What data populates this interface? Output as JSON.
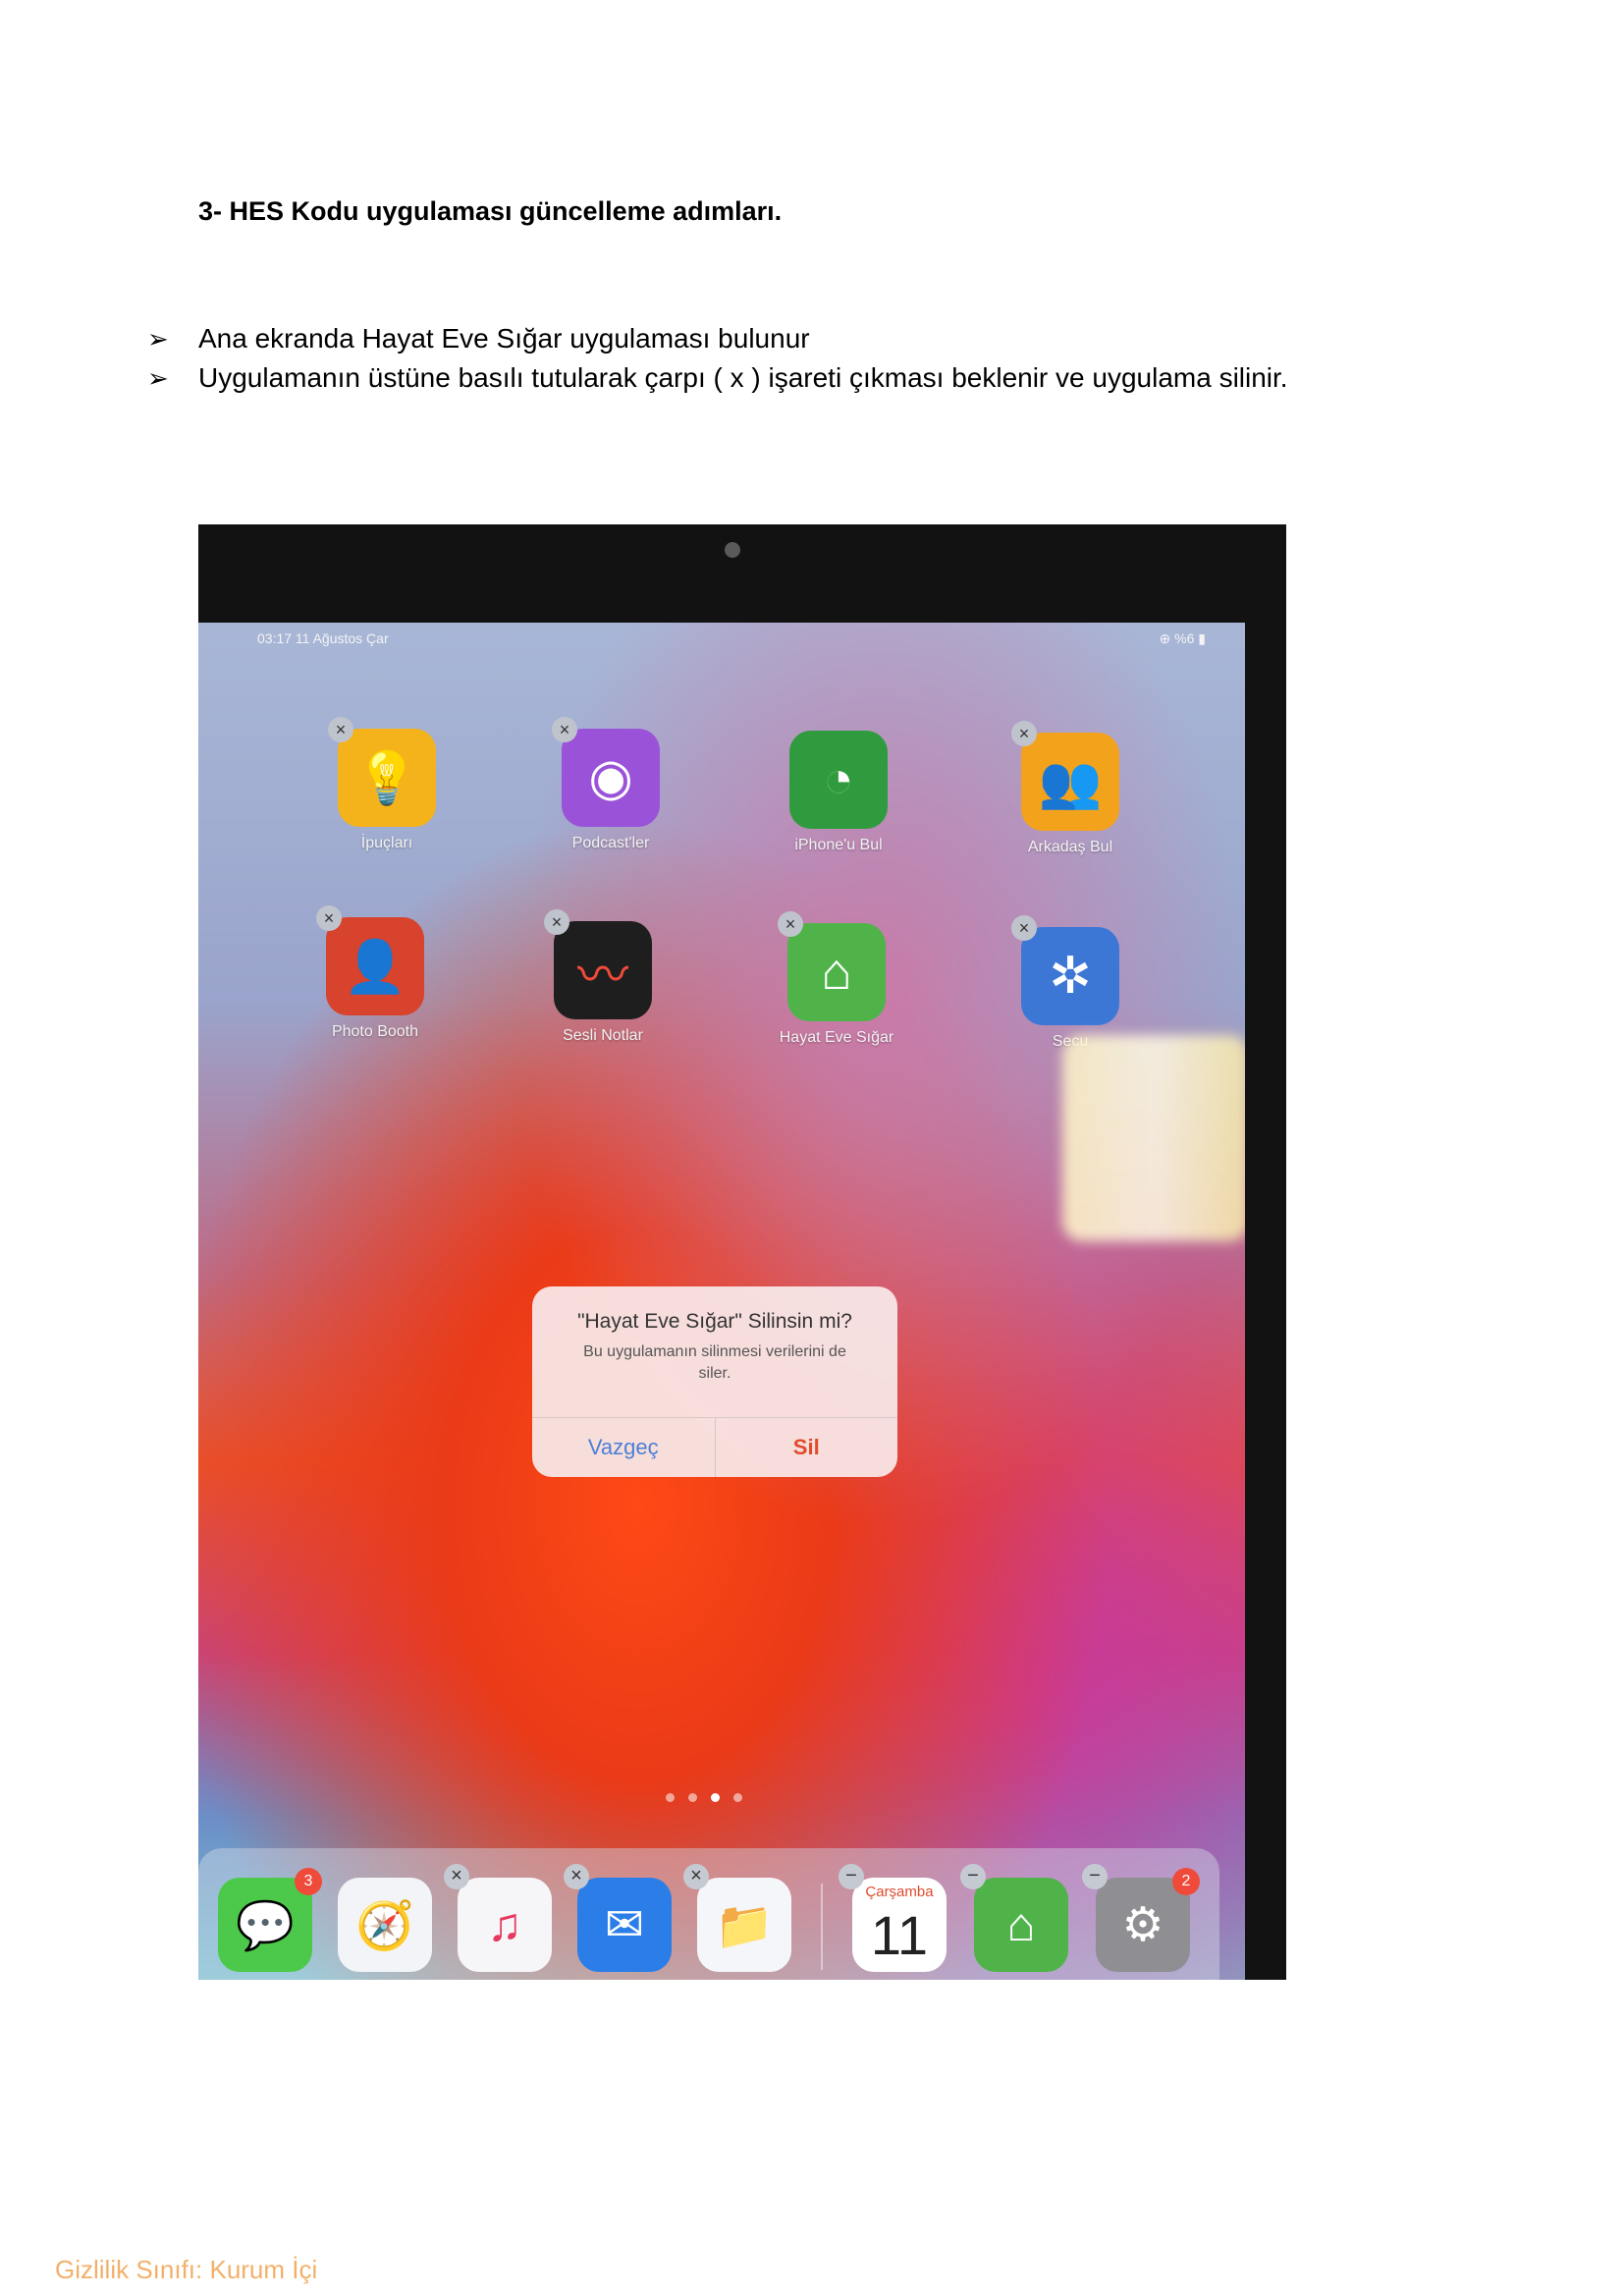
{
  "document": {
    "heading": "3- HES Kodu uygulaması güncelleme adımları.",
    "bullets": [
      "Ana ekranda Hayat Eve Sığar uygulaması bulunur",
      "Uygulamanın üstüne basılı tutularak çarpı ( x ) işareti çıkması beklenir ve uygulama silinir."
    ],
    "footer": "Gizlilik Sınıfı: Kurum İçi"
  },
  "screenshot": {
    "status": {
      "time_date": "03:17   11 Ağustos Çar",
      "battery": "%6"
    },
    "apps": [
      {
        "label": "İpuçları",
        "icon": "lightbulb-icon",
        "color": "#f4b31a",
        "delete_badge": true
      },
      {
        "label": "Podcast'ler",
        "icon": "podcast-icon",
        "color": "#9a52d9",
        "delete_badge": true
      },
      {
        "label": "iPhone'u Bul",
        "icon": "radar-icon",
        "color": "#2f9b3e",
        "delete_badge": false
      },
      {
        "label": "Arkadaş Bul",
        "icon": "friends-icon",
        "color": "#f3a21c",
        "delete_badge": true
      },
      {
        "label": "Photo Booth",
        "icon": "photo-booth-icon",
        "color": "#d7432c",
        "delete_badge": true
      },
      {
        "label": "Sesli Notlar",
        "icon": "voice-memo-icon",
        "color": "#1e1e1e",
        "delete_badge": true
      },
      {
        "label": "Hayat Eve Sığar",
        "icon": "house-hands-icon",
        "color": "#4fb34a",
        "delete_badge": true
      },
      {
        "label": "Secu",
        "icon": "security-icon",
        "color": "#3d77d6",
        "delete_badge": true
      }
    ],
    "alert": {
      "title": "\"Hayat Eve Sığar\" Silinsin mi?",
      "message": "Bu uygulamanın silinmesi verilerini de siler.",
      "cancel_label": "Vazgeç",
      "delete_label": "Sil"
    },
    "dock": {
      "messages_badge": "3",
      "calendar_day": "Çarşamba",
      "calendar_date": "11",
      "settings_badge": "2"
    }
  }
}
